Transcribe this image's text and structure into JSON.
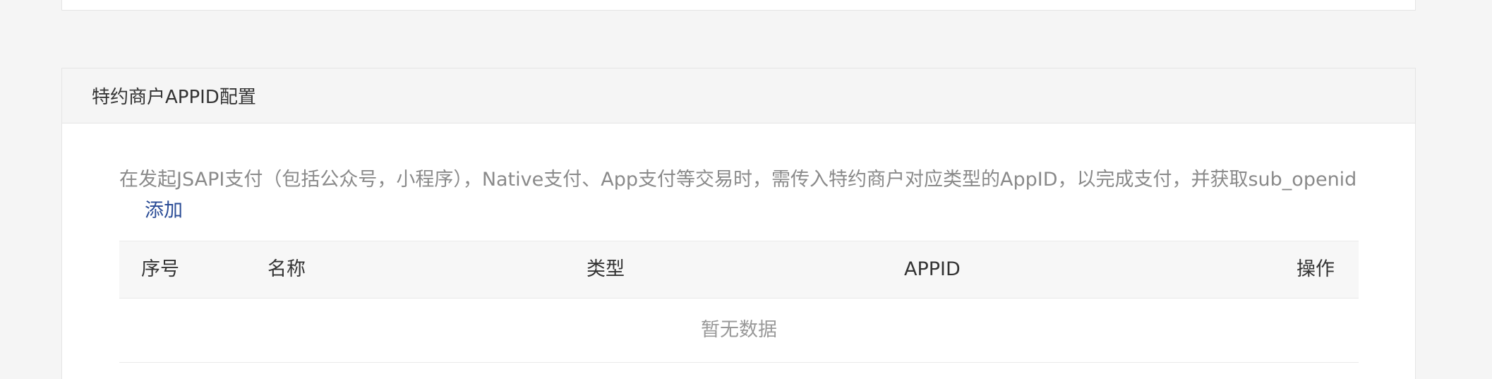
{
  "section": {
    "title": "特约商户APPID配置",
    "description": "在发起JSAPI支付（包括公众号，小程序），Native支付、App支付等交易时，需传入特约商户对应类型的AppID，以完成支付，并获取sub_openid",
    "add_link": "添加"
  },
  "table": {
    "columns": {
      "index": "序号",
      "name": "名称",
      "type": "类型",
      "appid": "APPID",
      "ops": "操作"
    },
    "empty_text": "暂无数据"
  },
  "colors": {
    "link": "#2a4c96",
    "muted_text": "#8a8a8a",
    "header_bg": "#f5f5f5"
  }
}
